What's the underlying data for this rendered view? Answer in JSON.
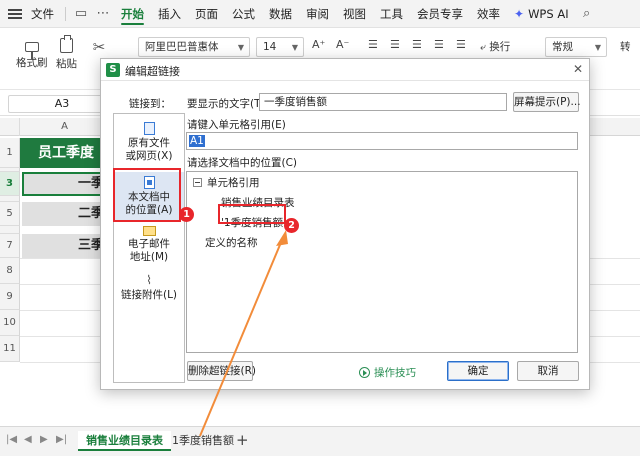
{
  "menubar": {
    "file": "文件",
    "tabs": [
      "开始",
      "插入",
      "页面",
      "公式",
      "数据",
      "审阅",
      "视图",
      "工具",
      "会员专享",
      "效率"
    ],
    "wps_ai": "WPS AI"
  },
  "toolbar": {
    "format_painter": "格式刷",
    "paste": "粘贴",
    "font_name": "阿里巴巴普惠体",
    "font_size": "14",
    "wrap_text": "换行",
    "number_format": "常规",
    "convert": "转"
  },
  "formula": {
    "namebox": "A3"
  },
  "sheet": {
    "columns": [
      "A"
    ],
    "rows": [
      "1",
      "2",
      "3",
      "4",
      "5",
      "6",
      "7",
      "8",
      "9",
      "10",
      "11"
    ],
    "title_cell": "员工季度",
    "cells": [
      "一季",
      "二季",
      "三季"
    ]
  },
  "tabs": {
    "sheet1": "销售业绩目录表",
    "sheet2": "1季度销售额",
    "add": "+"
  },
  "dialog": {
    "title": "编辑超链接",
    "close": "✕",
    "link_to_label": "链接到：",
    "display_text_label": "要显示的文字(T)：",
    "display_text_value": "一季度销售额",
    "screen_tip_button": "屏幕提示(P)...",
    "cell_ref_label": "请键入单元格引用(E)",
    "cell_ref_value": "A1",
    "location_label": "请选择文档中的位置(C)",
    "link_options": [
      {
        "line1": "原有文件",
        "line2": "或网页(X)"
      },
      {
        "line1": "本文档中",
        "line2": "的位置(A)"
      },
      {
        "line1": "电子邮件",
        "line2": "地址(M)"
      },
      {
        "line1": "链接附件(L)",
        "line2": ""
      }
    ],
    "tree": {
      "cell_ref_node": "单元格引用",
      "item_1": "销售业绩目录表",
      "item_2": "'1季度销售额'",
      "defined_names": "定义的名称"
    },
    "remove_link_button": "删除超链接(R)",
    "tips_link": "操作技巧",
    "ok_button": "确定",
    "cancel_button": "取消"
  },
  "annotations": {
    "badge1": "1",
    "badge2": "2",
    "color": "#e8262b",
    "arrow_color": "#f28c3a"
  }
}
